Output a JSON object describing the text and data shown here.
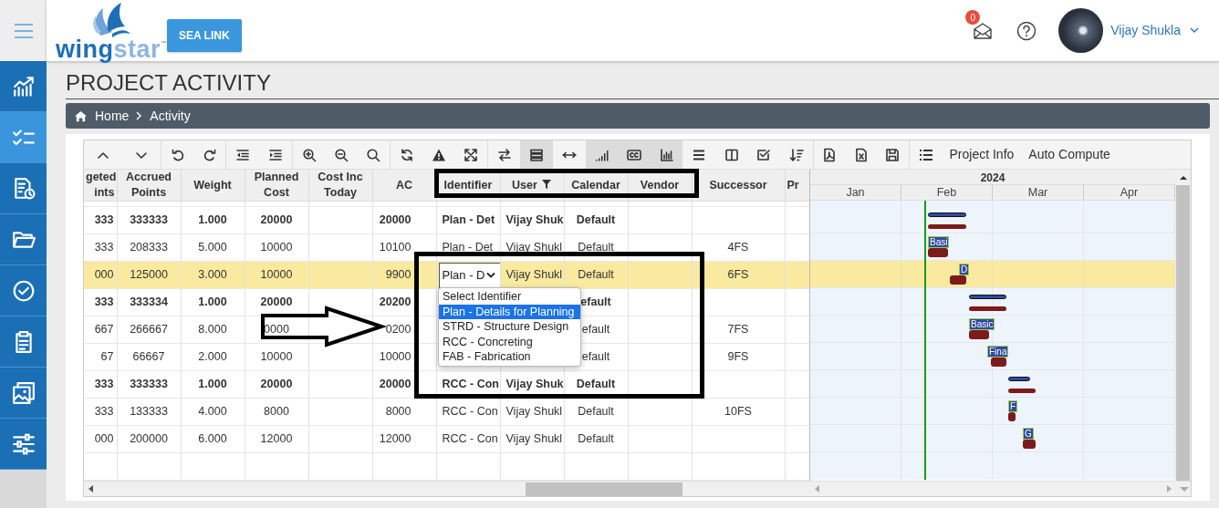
{
  "sidebar": {
    "items": [
      {
        "selected": false
      },
      {
        "selected": true
      },
      {
        "selected": false
      },
      {
        "selected": false
      },
      {
        "selected": false
      },
      {
        "selected": false
      },
      {
        "selected": false
      },
      {
        "selected": false
      }
    ]
  },
  "header": {
    "logo": {
      "parts": [
        "wing",
        "star"
      ],
      "mark": "™"
    },
    "button": "SEA LINK",
    "mail_badge": "0",
    "user_name": "Vijay Shukla"
  },
  "page_title": "PROJECT ACTIVITY",
  "breadcrumb": [
    "Home",
    "Activity"
  ],
  "toolbar": {
    "buttons": [
      {
        "pressed": false
      },
      {
        "pressed": false
      },
      {
        "pressed": false
      },
      {
        "pressed": false
      },
      {
        "pressed": false
      },
      {
        "pressed": false
      },
      {
        "pressed": false
      },
      {
        "pressed": false
      },
      {
        "pressed": false
      },
      {
        "pressed": false
      },
      {
        "pressed": false
      },
      {
        "pressed": false
      },
      {
        "pressed": false
      },
      {
        "pressed": true
      },
      {
        "pressed": false
      },
      {
        "pressed": true
      },
      {
        "pressed": true
      },
      {
        "pressed": true
      },
      {
        "pressed": false
      },
      {
        "pressed": false
      },
      {
        "pressed": false
      },
      {
        "pressed": false
      },
      {
        "pressed": false
      },
      {
        "pressed": false
      },
      {
        "pressed": false
      },
      {
        "pressed": false
      }
    ],
    "text_buttons": [
      "Project Info",
      "Auto Compute"
    ]
  },
  "table": {
    "columns": [
      {
        "label": "geted ints",
        "filtered": false
      },
      {
        "label": "Accrued Points",
        "filtered": false
      },
      {
        "label": "Weight",
        "filtered": false
      },
      {
        "label": "Planned Cost",
        "filtered": false
      },
      {
        "label": "Cost Inc Today",
        "filtered": false
      },
      {
        "label": "AC",
        "filtered": false
      },
      {
        "label": "Identifier",
        "filtered": false
      },
      {
        "label": "User",
        "filtered": true
      },
      {
        "label": "Calendar",
        "filtered": false
      },
      {
        "label": "Vendor",
        "filtered": false
      },
      {
        "label": "Successor",
        "filtered": false
      },
      {
        "label": "Pr",
        "filtered": false
      }
    ],
    "rows": [
      {
        "kind": "summary",
        "selected": false,
        "cells": [
          "333",
          "333333",
          "1.000",
          "20000",
          null,
          "20000",
          "Plan - Det",
          "Vijay Shuk",
          "Default",
          null,
          null,
          null
        ]
      },
      {
        "kind": "task",
        "selected": false,
        "cells": [
          "333",
          "208333",
          "5.000",
          "10000",
          null,
          "10100",
          "Plan - Det",
          "Vijay Shukl",
          "Default",
          null,
          "4FS",
          null
        ]
      },
      {
        "kind": "task",
        "selected": true,
        "editing": {
          "value": "Plan - D"
        },
        "cells": [
          "000",
          "125000",
          "3.000",
          "10000",
          null,
          "9900",
          null,
          "Vijay Shukl",
          "Default",
          null,
          "6FS",
          null
        ]
      },
      {
        "kind": "summary",
        "selected": false,
        "cells": [
          "333",
          "333334",
          "1.000",
          "20000",
          null,
          "20200",
          null,
          null,
          "efault",
          null,
          null,
          null
        ]
      },
      {
        "kind": "task",
        "selected": false,
        "cells": [
          "667",
          "266667",
          "8.000",
          "0000",
          null,
          "0200",
          null,
          null,
          "efault",
          null,
          "7FS",
          null
        ]
      },
      {
        "kind": "task",
        "selected": false,
        "cells": [
          "67",
          "66667",
          "2.000",
          "10000",
          null,
          "10000",
          null,
          null,
          "efault",
          null,
          "9FS",
          null
        ]
      },
      {
        "kind": "summary",
        "selected": false,
        "cells": [
          "333",
          "333333",
          "1.000",
          "20000",
          null,
          "20000",
          "RCC - Con",
          "Vijay Shuk",
          "Default",
          null,
          null,
          null
        ]
      },
      {
        "kind": "task",
        "selected": false,
        "cells": [
          "333",
          "133333",
          "4.000",
          "8000",
          null,
          "8000",
          "RCC - Con",
          "Vijay Shukl",
          "Default",
          null,
          "10FS",
          null
        ]
      },
      {
        "kind": "task",
        "selected": false,
        "cells": [
          "000",
          "200000",
          "6.000",
          "12000",
          null,
          "12000",
          "RCC - Con",
          "Vijay Shukl",
          "Default",
          null,
          null,
          null
        ]
      }
    ]
  },
  "dropdown": {
    "options": [
      {
        "label": "Select Identifier",
        "selected": false
      },
      {
        "label": "Plan - Details for Planning",
        "selected": true
      },
      {
        "label": "STRD - Structure Design",
        "selected": false
      },
      {
        "label": "RCC - Concreting",
        "selected": false
      },
      {
        "label": "FAB - Fabrication",
        "selected": false
      }
    ]
  },
  "gantt": {
    "year": "2024",
    "months": [
      "Jan",
      "Feb",
      "Mar",
      "Apr"
    ],
    "rows": [
      {
        "kind": "summary"
      },
      {
        "kind": "task",
        "label": "Basi"
      },
      {
        "kind": "task",
        "label": "D"
      },
      {
        "kind": "summary"
      },
      {
        "kind": "task",
        "label": "Basic"
      },
      {
        "kind": "task",
        "label": "Fina"
      },
      {
        "kind": "summary"
      },
      {
        "kind": "task",
        "label": "F"
      },
      {
        "kind": "task",
        "label": "G"
      }
    ]
  }
}
